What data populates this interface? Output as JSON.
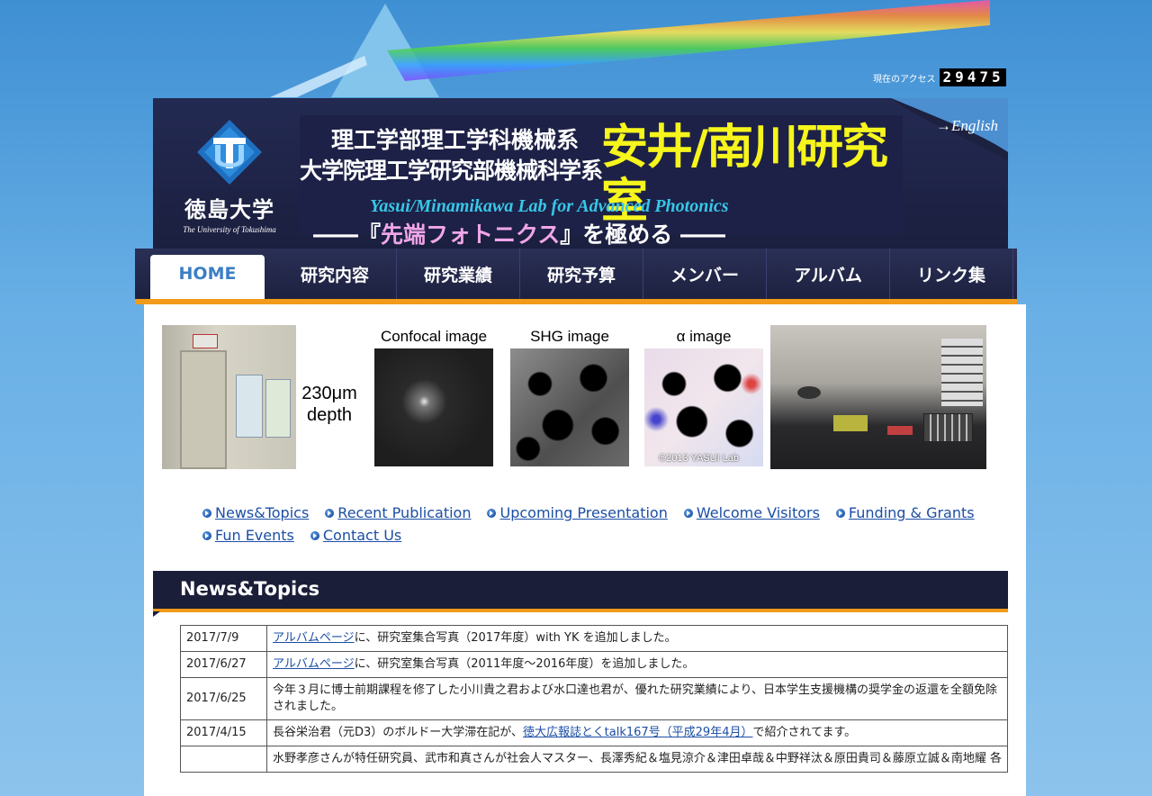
{
  "access_counter": {
    "label": "現在のアクセス",
    "value": "29475"
  },
  "header": {
    "logo": {
      "university_jp": "徳島大学",
      "university_en": "The University of Tokushima"
    },
    "banner": {
      "line1": "理工学部理工学科機械系",
      "line2": "大学院理工学研究部機械科学系",
      "lab_name": "安井/南川研究室",
      "lab_name_en": "Yasui/Minamikawa Lab for Advanced Photonics",
      "tagline_prefix": "――『",
      "tagline_highlight": "先端フォトニクス",
      "tagline_suffix": "』を極める ――"
    },
    "english_link": "→English"
  },
  "nav": {
    "items": [
      {
        "label": "HOME",
        "active": true
      },
      {
        "label": "研究内容"
      },
      {
        "label": "研究業績"
      },
      {
        "label": "研究予算"
      },
      {
        "label": "メンバー"
      },
      {
        "label": "アルバム"
      },
      {
        "label": "リンク集"
      }
    ]
  },
  "image_strip": {
    "depth_line1": "230μm",
    "depth_line2": "depth",
    "captions": [
      "Confocal image",
      "SHG image",
      "α image"
    ],
    "copyright": "©2013 YASUI Lab"
  },
  "quick_links": [
    "News&Topics",
    "Recent Publication",
    "Upcoming Presentation",
    "Welcome Visitors",
    "Funding & Grants",
    "Fun Events",
    "Contact Us"
  ],
  "news": {
    "title": "News&Topics",
    "rows": [
      {
        "date": "2017/7/9",
        "link": "アルバムページ",
        "text": "に、研究室集合写真（2017年度）with YK を追加しました。"
      },
      {
        "date": "2017/6/27",
        "link": "アルバムページ",
        "text": "に、研究室集合写真（2011年度〜2016年度）を追加しました。"
      },
      {
        "date": "2017/6/25",
        "link": "",
        "text": "今年３月に博士前期課程を修了した小川貴之君および水口達也君が、優れた研究業績により、日本学生支援機構の奨学金の返還を全額免除されました。"
      },
      {
        "date": "2017/4/15",
        "pre": "長谷栄治君（元D3）のボルドー大学滞在記が、",
        "link": "徳大広報誌とくtalk167号（平成29年4月）",
        "text": "で紹介されてます。"
      },
      {
        "date": "",
        "link": "",
        "text": "水野孝彦さんが特任研究員、武市和真さんが社会人マスター、長澤秀紀＆塩見涼介＆津田卓哉＆中野祥汰＆原田貴司＆藤原立誠＆南地耀 各"
      }
    ]
  }
}
